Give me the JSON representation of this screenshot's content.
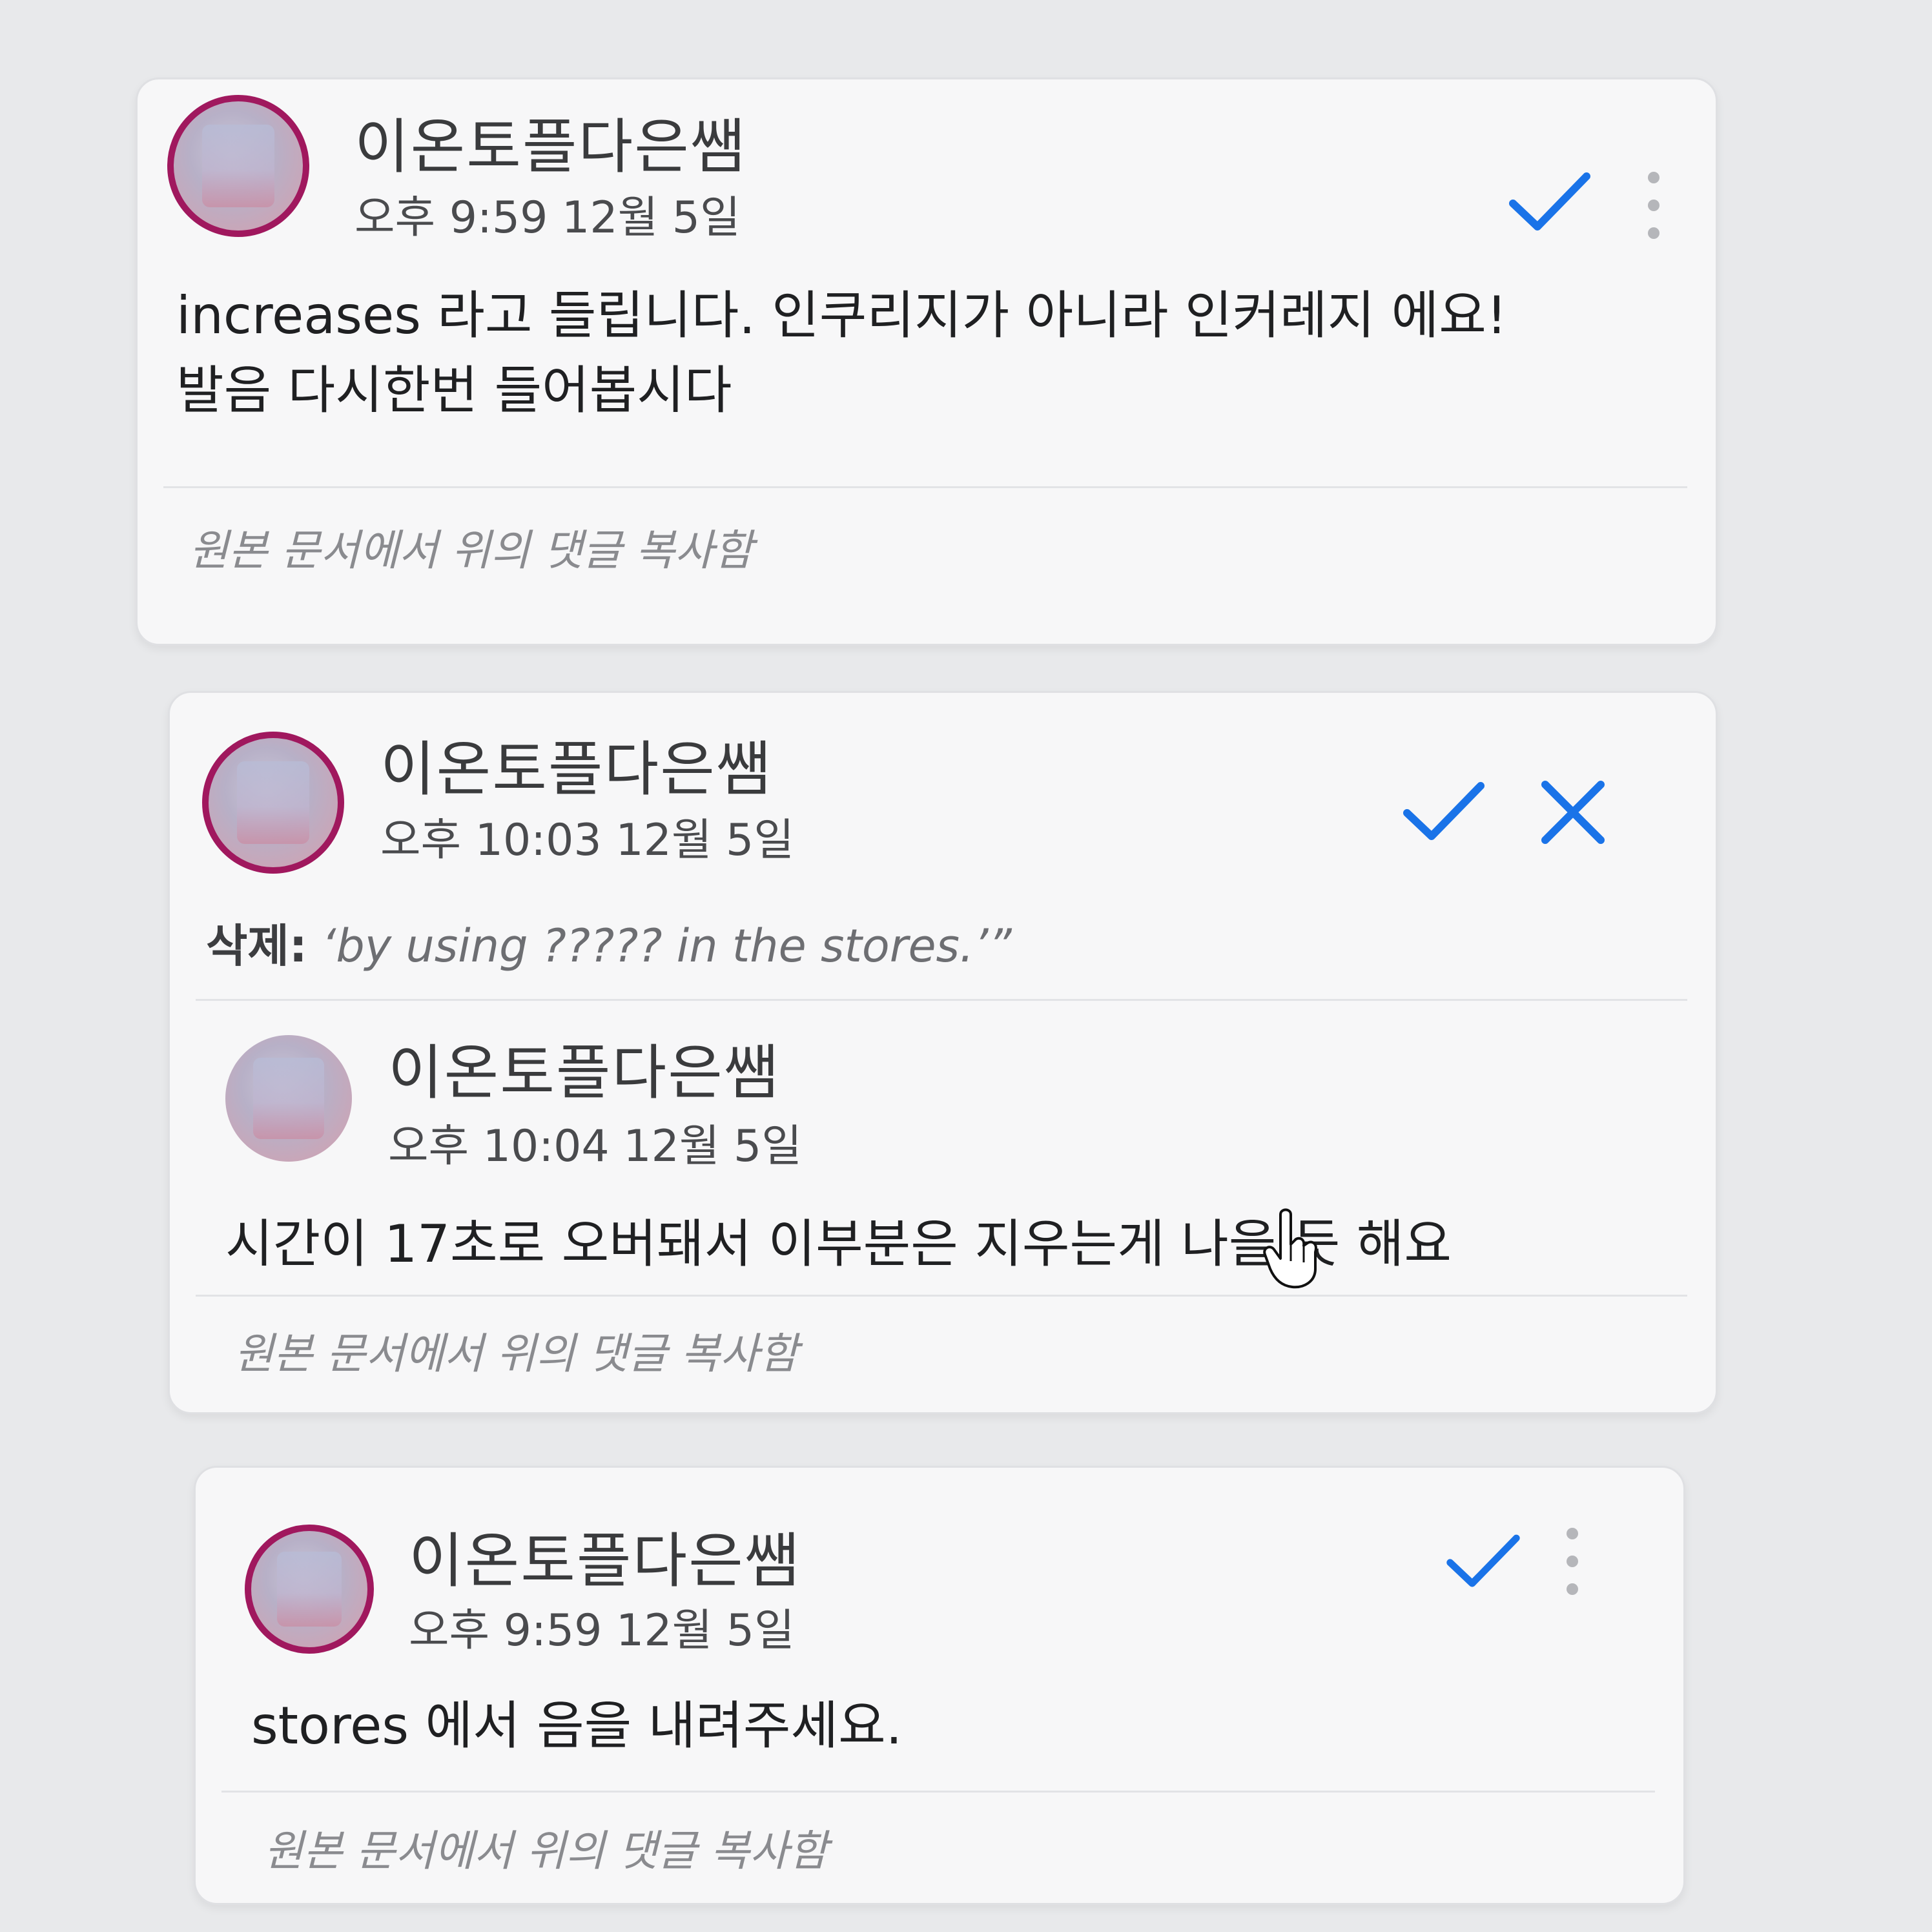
{
  "comments": [
    {
      "author": "이온토플다은쌤",
      "time": "오후 9:59 12월 5일",
      "text_line1": "increases 라고 들립니다. 인쿠리지가 아니라 인커레지 에요!",
      "text_line2": "발음 다시한번 들어봅시다",
      "footer": "원본 문서에서 위의 댓글 복사함",
      "icons": [
        "check-icon",
        "more-vert-icon"
      ]
    },
    {
      "author": "이온토플다은쌤",
      "time": "오후 10:03 12월 5일",
      "delete_label": "삭제:",
      "delete_text": "‘by using ????? in the stores.’”",
      "icons": [
        "check-icon",
        "close-icon"
      ],
      "reply": {
        "author": "이온토플다은쌤",
        "time": "오후 10:04 12월 5일",
        "text": "시간이 17초로 오버돼서 이부분은 지우는게 나을 듯 해요"
      },
      "footer": "원본 문서에서 위의 댓글 복사함"
    },
    {
      "author": "이온토플다은쌤",
      "time": "오후 9:59 12월 5일",
      "text": "stores 에서 음을 내려주세요.",
      "footer": "원본 문서에서 위의 댓글 복사함",
      "icons": [
        "check-icon",
        "more-vert-icon"
      ]
    }
  ],
  "colors": {
    "accent": "#1a73e8",
    "avatar_ring": "#a0185e"
  }
}
